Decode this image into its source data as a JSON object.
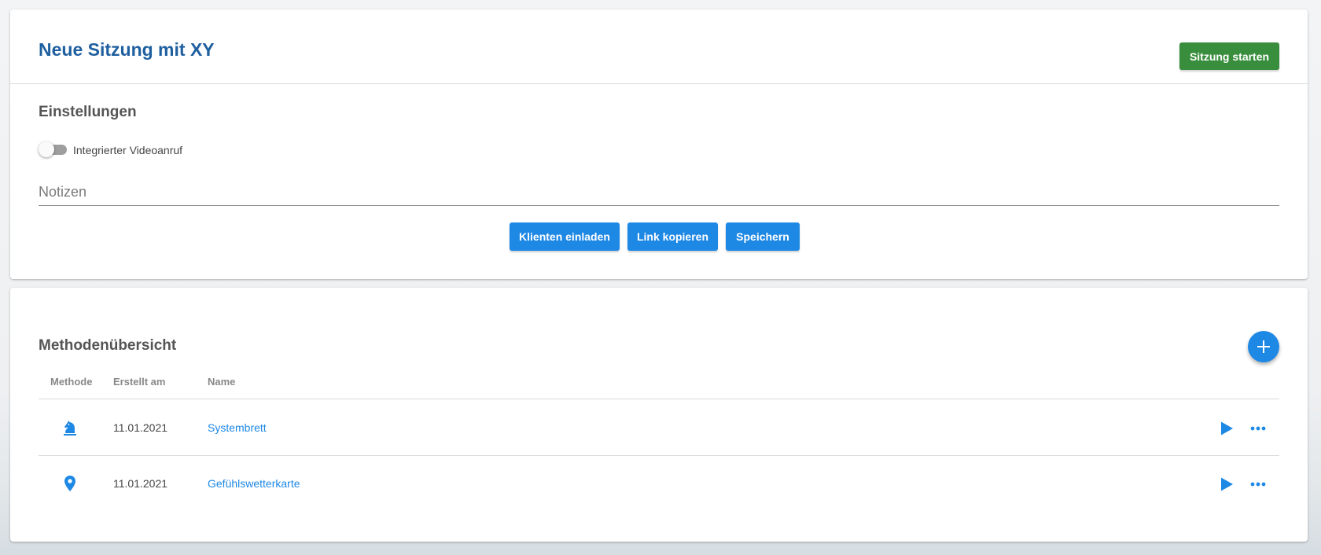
{
  "header": {
    "title": "Neue Sitzung mit XY",
    "start_button": "Sitzung starten"
  },
  "settings": {
    "title": "Einstellungen",
    "video_toggle_label": "Integrierter Videoanruf",
    "video_toggle_on": false,
    "notes_placeholder": "Notizen",
    "notes_value": ""
  },
  "actions": {
    "invite": "Klienten einladen",
    "copy_link": "Link kopieren",
    "save": "Speichern"
  },
  "methods": {
    "title": "Methodenübersicht",
    "add_icon": "plus-icon",
    "columns": [
      "Methode",
      "Erstellt am",
      "Name"
    ],
    "rows": [
      {
        "icon": "chess-knight-icon",
        "created": "11.01.2021",
        "name": "Systembrett"
      },
      {
        "icon": "map-marker-icon",
        "created": "11.01.2021",
        "name": "Gefühlswetterkarte"
      }
    ]
  },
  "colors": {
    "title_blue": "#1e5f9f",
    "primary": "#1e88e5",
    "success": "#388e3c"
  }
}
